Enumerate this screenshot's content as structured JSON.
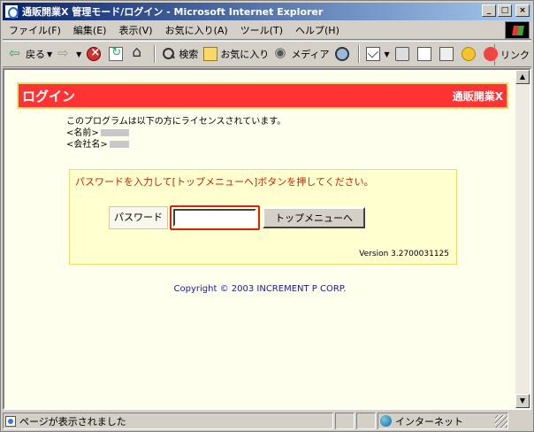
{
  "window": {
    "title": "通販開業X 管理モード/ログイン - Microsoft Internet Explorer",
    "controls": {
      "minimize": "_",
      "maximize": "□",
      "close": "×"
    }
  },
  "menu": {
    "items": [
      "ファイル(F)",
      "編集(E)",
      "表示(V)",
      "お気に入り(A)",
      "ツール(T)",
      "ヘルプ(H)"
    ]
  },
  "toolbar": {
    "back_label": "戻る",
    "search_label": "検索",
    "favorites_label": "お気に入り",
    "media_label": "メディア",
    "links_label": "リンク"
  },
  "page": {
    "header_title": "ログイン",
    "header_brand": "通販開業X",
    "header_color": "#ff3333",
    "license_line": "このプログラムは以下の方にライセンスされています。",
    "name_label": "<名前>",
    "company_label": "<会社名>",
    "instruction": "パスワードを入力して[トップメニューへ]ボタンを押してください。",
    "password_label": "パスワード",
    "password_value": "",
    "submit_label": "トップメニューへ",
    "version": "Version 3.2700031125",
    "copyright": "Copyright © 2003 INCREMENT P CORP."
  },
  "statusbar": {
    "status_text": "ページが表示されました",
    "zone": "インターネット"
  }
}
